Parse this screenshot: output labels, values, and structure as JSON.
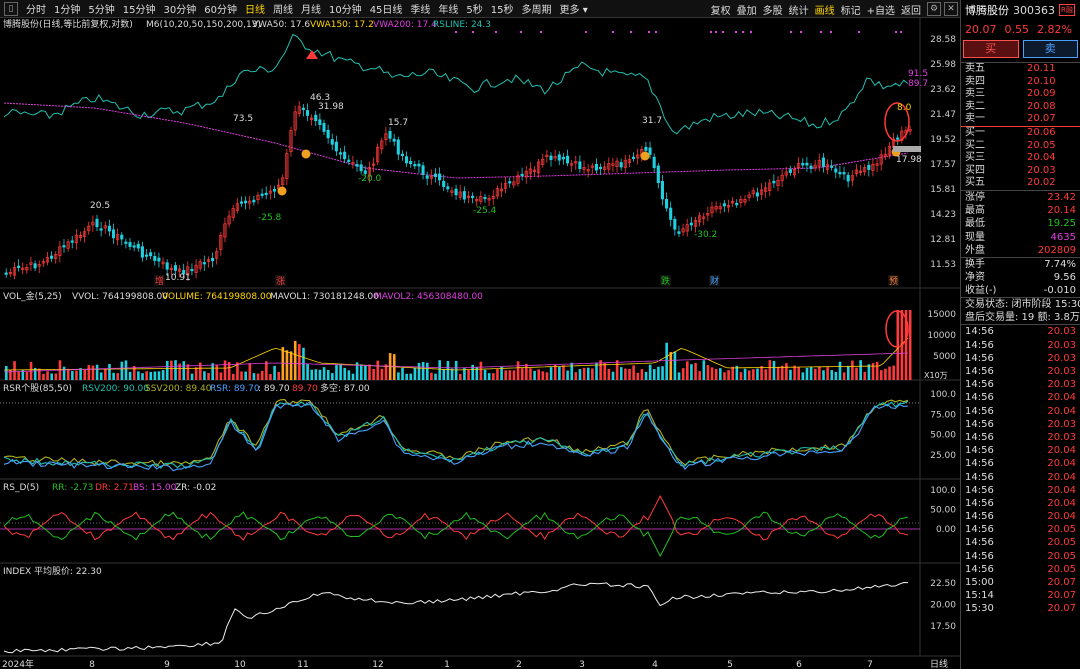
{
  "toolbar": {
    "menu_icon": "menu-icon",
    "periods": [
      "分时",
      "1分钟",
      "5分钟",
      "15分钟",
      "30分钟",
      "60分钟",
      "日线",
      "周线",
      "月线",
      "10分钟",
      "45日线",
      "季线",
      "年线",
      "5秒",
      "15秒",
      "多周期",
      "更多 ▾"
    ],
    "active_period": "日线",
    "right_items": [
      "复权",
      "叠加",
      "多股",
      "统计",
      "画线",
      "标记",
      "+自选",
      "返回"
    ],
    "highlight_right": "画线"
  },
  "main_panel": {
    "legend_name": "博腾股份(日线,等比前复权,对数)",
    "legend_m6": "M6(10,20,50,150,200,13)",
    "legend_vwa50": "VWA50: 17.6",
    "legend_vwa150": "VWA150: 17.2",
    "legend_vwa200": "VWA200: 17.4",
    "legend_rsline": "RSLINE: 24.3",
    "y_labels": [
      "28.58",
      "25.98",
      "23.62",
      "21.47",
      "19.52",
      "17.57",
      "15.81",
      "14.23",
      "12.81",
      "11.53"
    ],
    "annotations": [
      "20.5",
      "10.91",
      "73.5",
      "-25.8",
      "46.3",
      "31.98",
      "15.7",
      "-20.0",
      "-25.4",
      "31.7",
      "-30.2",
      "91.5",
      "89.7",
      "8.0",
      "17.98"
    ],
    "markers": [
      "增",
      "涨",
      "跌",
      "财",
      "预"
    ],
    "colors": {
      "up": "#ff3a3a",
      "down": "#20d0e0",
      "rsline": "#20c0b0",
      "vwa200": "#e040e0",
      "vwa150": "#ffd700"
    }
  },
  "volume_panel": {
    "legend_name": "VOL_金(5,25)",
    "legend_vvol": "VVOL: 764199808.00",
    "legend_volume": "VOLUME: 764199808.00",
    "legend_mavol1": "MAVOL1: 730181248.00",
    "legend_mavol2": "MAVOL2: 456308480.00",
    "y_labels": [
      "15000",
      "10000",
      "5000"
    ],
    "unit": "X10万"
  },
  "rsr_panel": {
    "legend_name": "RSR个股(85,50)",
    "legend_rsv": "RSV200: 90.00",
    "legend_ssv": "SSV200: 89.40",
    "legend_rsr": "RSR: 89.70",
    "legend_v1": ": 89.70",
    "legend_v2": "89.70",
    "legend_duo": "多空: 87.00",
    "y_labels": [
      "100.0",
      "75.00",
      "50.00",
      "25.00"
    ]
  },
  "rsd_panel": {
    "legend_name": "RS_D(5)",
    "legend_rr": "RR: -2.73",
    "legend_dr": "DR: 2.71",
    "legend_bs": "BS: 15.00",
    "legend_zr": "ZR: -0.02",
    "y_labels": [
      "100.0",
      "50.00",
      "0.00"
    ]
  },
  "index_panel": {
    "legend_name": "INDEX 平均股价: 22.30",
    "y_labels": [
      "22.50",
      "20.00",
      "17.50"
    ]
  },
  "x_axis": {
    "labels": [
      "2024年",
      "8",
      "9",
      "10",
      "11",
      "12",
      "1",
      "2",
      "3",
      "4",
      "5",
      "6",
      "7"
    ],
    "period": "日线"
  },
  "right_panel": {
    "name": "博腾股份",
    "code": "300363",
    "flag": "R融",
    "price": "20.07",
    "change": "0.55",
    "change_pct": "2.82%",
    "buy_label": "买",
    "sell_label": "卖",
    "asks": [
      {
        "label": "卖五",
        "price": "20.11"
      },
      {
        "label": "卖四",
        "price": "20.10"
      },
      {
        "label": "卖三",
        "price": "20.09"
      },
      {
        "label": "卖二",
        "price": "20.08"
      },
      {
        "label": "卖一",
        "price": "20.07"
      }
    ],
    "bids": [
      {
        "label": "买一",
        "price": "20.06"
      },
      {
        "label": "买二",
        "price": "20.05"
      },
      {
        "label": "买三",
        "price": "20.04"
      },
      {
        "label": "买四",
        "price": "20.03"
      },
      {
        "label": "买五",
        "price": "20.02"
      }
    ],
    "stats": [
      {
        "label": "涨停",
        "value": "23.42",
        "cls": "v-red"
      },
      {
        "label": "最高",
        "value": "20.14",
        "cls": "v-red"
      },
      {
        "label": "最低",
        "value": "19.25",
        "cls": "v-green"
      },
      {
        "label": "现量",
        "value": "4635",
        "cls": "v-mag"
      },
      {
        "label": "外盘",
        "value": "202809",
        "cls": "v-red"
      }
    ],
    "stats2": [
      {
        "label": "换手",
        "value": "7.74%",
        "cls": "v-white"
      },
      {
        "label": "净资",
        "value": "9.56",
        "cls": "v-white"
      },
      {
        "label": "收益(-)",
        "value": "-0.010",
        "cls": "v-white"
      }
    ],
    "status_line": "交易状态: 闭市阶段 15:30",
    "after_hours": "盘后交易量: 19  额: 3.8万",
    "ticks": [
      {
        "t": "14:56",
        "p": "20.03"
      },
      {
        "t": "14:56",
        "p": "20.03"
      },
      {
        "t": "14:56",
        "p": "20.03"
      },
      {
        "t": "14:56",
        "p": "20.03"
      },
      {
        "t": "14:56",
        "p": "20.03"
      },
      {
        "t": "14:56",
        "p": "20.04"
      },
      {
        "t": "14:56",
        "p": "20.04"
      },
      {
        "t": "14:56",
        "p": "20.03"
      },
      {
        "t": "14:56",
        "p": "20.03"
      },
      {
        "t": "14:56",
        "p": "20.04"
      },
      {
        "t": "14:56",
        "p": "20.04"
      },
      {
        "t": "14:56",
        "p": "20.04"
      },
      {
        "t": "14:56",
        "p": "20.04"
      },
      {
        "t": "14:56",
        "p": "20.04"
      },
      {
        "t": "14:56",
        "p": "20.04"
      },
      {
        "t": "14:56",
        "p": "20.05"
      },
      {
        "t": "14:56",
        "p": "20.05"
      },
      {
        "t": "14:56",
        "p": "20.05"
      },
      {
        "t": "14:56",
        "p": "20.05"
      },
      {
        "t": "15:00",
        "p": "20.07"
      },
      {
        "t": "15:14",
        "p": "20.07"
      },
      {
        "t": "15:30",
        "p": "20.07"
      }
    ]
  }
}
